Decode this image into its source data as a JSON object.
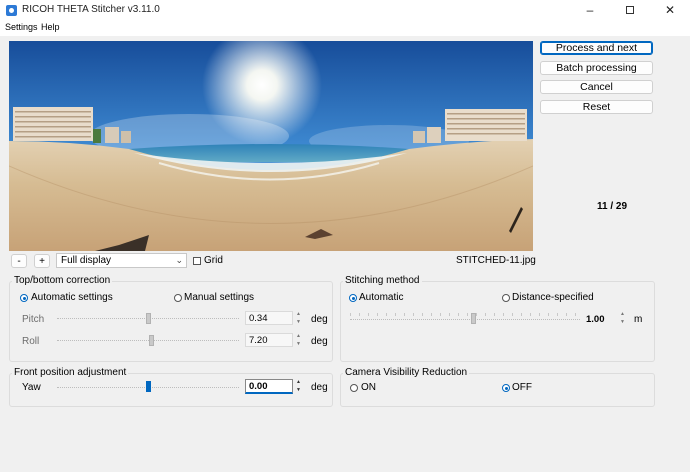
{
  "window": {
    "title": "RICOH THETA Stitcher v3.11.0"
  },
  "menu": {
    "items": [
      "Settings",
      "Help"
    ]
  },
  "actions": {
    "process_next": "Process and next",
    "batch": "Batch processing",
    "cancel": "Cancel",
    "reset": "Reset"
  },
  "counter": "11 / 29",
  "preview_bar": {
    "zoom_out": "-",
    "zoom_in": "+",
    "display_mode": "Full display",
    "grid_label": "Grid",
    "grid_checked": false,
    "filename": "STITCHED-11.jpg"
  },
  "top_bottom": {
    "title": "Top/bottom correction",
    "auto_label": "Automatic settings",
    "manual_label": "Manual settings",
    "selected": "auto",
    "pitch_label": "Pitch",
    "pitch_value": "0.34",
    "roll_label": "Roll",
    "roll_value": "7.20",
    "unit": "deg"
  },
  "stitching": {
    "title": "Stitching method",
    "auto_label": "Automatic",
    "distance_label": "Distance-specified",
    "selected": "auto",
    "distance_value": "1.00",
    "unit": "m"
  },
  "front_position": {
    "title": "Front position adjustment",
    "yaw_label": "Yaw",
    "yaw_value": "0.00",
    "unit": "deg"
  },
  "camera_visibility": {
    "title": "Camera Visibility Reduction",
    "on_label": "ON",
    "off_label": "OFF",
    "selected": "off"
  },
  "colors": {
    "accent": "#0067c0",
    "window_bg": "#f0f0f0"
  }
}
